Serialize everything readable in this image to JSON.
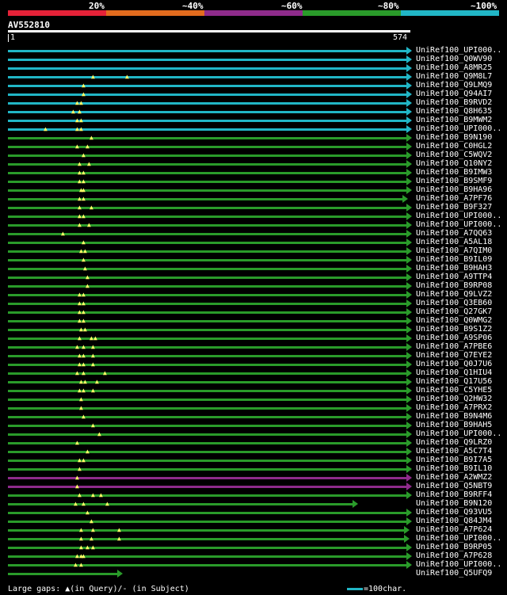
{
  "legend": {
    "labels": [
      "20%",
      "~40%",
      "~60%",
      "~80%",
      "~100%"
    ],
    "colors": [
      "#e52238",
      "#e36c1e",
      "#8e2b8b",
      "#2a9b2a",
      "#21b6c6"
    ]
  },
  "query": {
    "title": "AV552810",
    "start": "1",
    "end": "574"
  },
  "colors": {
    "cyan": "#21b6c6",
    "green": "#2a9b2a",
    "purple": "#8e2b8b",
    "gap_marker": "#ffff66"
  },
  "hits": [
    {
      "label": "UniRef100_UPI000..",
      "color": "cyan",
      "end_frac": 1.0,
      "gaps": []
    },
    {
      "label": "UniRef100_Q0WV90",
      "color": "cyan",
      "end_frac": 1.0,
      "gaps": []
    },
    {
      "label": "UniRef100_A8MR25",
      "color": "cyan",
      "end_frac": 1.0,
      "gaps": []
    },
    {
      "label": "UniRef100_Q9M8L7",
      "color": "cyan",
      "end_frac": 1.0,
      "gaps": [
        0.215,
        0.3
      ]
    },
    {
      "label": "UniRef100_Q9LMQ9",
      "color": "cyan",
      "end_frac": 1.0,
      "gaps": [
        0.19
      ]
    },
    {
      "label": "UniRef100_Q94AI7",
      "color": "cyan",
      "end_frac": 1.0,
      "gaps": [
        0.19
      ]
    },
    {
      "label": "UniRef100_B9RVD2",
      "color": "cyan",
      "end_frac": 1.0,
      "gaps": [
        0.175,
        0.185
      ]
    },
    {
      "label": "UniRef100_Q8H635",
      "color": "cyan",
      "end_frac": 1.0,
      "gaps": [
        0.165,
        0.18
      ]
    },
    {
      "label": "UniRef100_B9MWM2",
      "color": "cyan",
      "end_frac": 1.0,
      "gaps": [
        0.175,
        0.185
      ]
    },
    {
      "label": "UniRef100_UPI000..",
      "color": "cyan",
      "end_frac": 1.0,
      "gaps": [
        0.095,
        0.175,
        0.185
      ]
    },
    {
      "label": "UniRef100_B9N190",
      "color": "green",
      "end_frac": 1.0,
      "gaps": [
        0.21
      ]
    },
    {
      "label": "UniRef100_C0HGL2",
      "color": "green",
      "end_frac": 1.0,
      "gaps": [
        0.175,
        0.2
      ]
    },
    {
      "label": "UniRef100_C5WQV2",
      "color": "green",
      "end_frac": 1.0,
      "gaps": [
        0.19
      ]
    },
    {
      "label": "UniRef100_Q10NY2",
      "color": "green",
      "end_frac": 1.0,
      "gaps": [
        0.18,
        0.205
      ]
    },
    {
      "label": "UniRef100_B9IMW3",
      "color": "green",
      "end_frac": 1.0,
      "gaps": [
        0.18,
        0.19
      ]
    },
    {
      "label": "UniRef100_B9SMF9",
      "color": "green",
      "end_frac": 1.0,
      "gaps": [
        0.18,
        0.19
      ]
    },
    {
      "label": "UniRef100_B9HA96",
      "color": "green",
      "end_frac": 1.0,
      "gaps": [
        0.185,
        0.19
      ]
    },
    {
      "label": "UniRef100_A7PF76",
      "color": "green",
      "end_frac": 0.99,
      "gaps": [
        0.18,
        0.19
      ]
    },
    {
      "label": "UniRef100_B9F327",
      "color": "green",
      "end_frac": 1.0,
      "gaps": [
        0.18,
        0.21
      ]
    },
    {
      "label": "UniRef100_UPI000..",
      "color": "green",
      "end_frac": 1.0,
      "gaps": [
        0.18,
        0.19
      ]
    },
    {
      "label": "UniRef100_UPI000..",
      "color": "green",
      "end_frac": 1.0,
      "gaps": [
        0.18,
        0.205
      ]
    },
    {
      "label": "UniRef100_A7QQ63",
      "color": "green",
      "end_frac": 1.0,
      "gaps": [
        0.14
      ]
    },
    {
      "label": "UniRef100_A5AL18",
      "color": "green",
      "end_frac": 1.0,
      "gaps": [
        0.19
      ]
    },
    {
      "label": "UniRef100_A7QIM0",
      "color": "green",
      "end_frac": 1.0,
      "gaps": [
        0.185,
        0.195
      ]
    },
    {
      "label": "UniRef100_B9IL09",
      "color": "green",
      "end_frac": 1.0,
      "gaps": [
        0.19
      ]
    },
    {
      "label": "UniRef100_B9HAH3",
      "color": "green",
      "end_frac": 1.0,
      "gaps": [
        0.195
      ]
    },
    {
      "label": "UniRef100_A9TTP4",
      "color": "green",
      "end_frac": 1.0,
      "gaps": [
        0.2
      ]
    },
    {
      "label": "UniRef100_B9RP08",
      "color": "green",
      "end_frac": 1.0,
      "gaps": [
        0.2
      ]
    },
    {
      "label": "UniRef100_Q9LVZ2",
      "color": "green",
      "end_frac": 1.0,
      "gaps": [
        0.18,
        0.19
      ]
    },
    {
      "label": "UniRef100_Q3EB60",
      "color": "green",
      "end_frac": 1.0,
      "gaps": [
        0.18,
        0.19
      ]
    },
    {
      "label": "UniRef100_Q27GK7",
      "color": "green",
      "end_frac": 1.0,
      "gaps": [
        0.18,
        0.19
      ]
    },
    {
      "label": "UniRef100_Q0WMG2",
      "color": "green",
      "end_frac": 1.0,
      "gaps": [
        0.18,
        0.19
      ]
    },
    {
      "label": "UniRef100_B9S1Z2",
      "color": "green",
      "end_frac": 1.0,
      "gaps": [
        0.185,
        0.195
      ]
    },
    {
      "label": "UniRef100_A9SP06",
      "color": "green",
      "end_frac": 1.0,
      "gaps": [
        0.18,
        0.21,
        0.22
      ]
    },
    {
      "label": "UniRef100_A7PBE6",
      "color": "green",
      "end_frac": 1.0,
      "gaps": [
        0.175,
        0.19,
        0.215
      ]
    },
    {
      "label": "UniRef100_Q7EYE2",
      "color": "green",
      "end_frac": 1.0,
      "gaps": [
        0.18,
        0.19,
        0.215
      ]
    },
    {
      "label": "UniRef100_Q0J7U6",
      "color": "green",
      "end_frac": 1.0,
      "gaps": [
        0.18,
        0.19,
        0.215
      ]
    },
    {
      "label": "UniRef100_Q1HIU4",
      "color": "green",
      "end_frac": 1.0,
      "gaps": [
        0.175,
        0.19,
        0.245
      ]
    },
    {
      "label": "UniRef100_Q17U56",
      "color": "green",
      "end_frac": 1.0,
      "gaps": [
        0.185,
        0.195,
        0.225
      ]
    },
    {
      "label": "UniRef100_C5YHE5",
      "color": "green",
      "end_frac": 1.0,
      "gaps": [
        0.18,
        0.19,
        0.215
      ]
    },
    {
      "label": "UniRef100_Q2HW32",
      "color": "green",
      "end_frac": 1.0,
      "gaps": [
        0.185
      ]
    },
    {
      "label": "UniRef100_A7PRX2",
      "color": "green",
      "end_frac": 1.0,
      "gaps": [
        0.185
      ]
    },
    {
      "label": "UniRef100_B9N4M6",
      "color": "green",
      "end_frac": 1.0,
      "gaps": [
        0.19
      ]
    },
    {
      "label": "UniRef100_B9HAH5",
      "color": "green",
      "end_frac": 1.0,
      "gaps": [
        0.215
      ]
    },
    {
      "label": "UniRef100_UPI000..",
      "color": "green",
      "end_frac": 1.0,
      "gaps": [
        0.23
      ]
    },
    {
      "label": "UniRef100_Q9LRZ0",
      "color": "green",
      "end_frac": 1.0,
      "gaps": [
        0.175
      ]
    },
    {
      "label": "UniRef100_A5C7T4",
      "color": "green",
      "end_frac": 1.0,
      "gaps": [
        0.2
      ]
    },
    {
      "label": "UniRef100_B9I7A5",
      "color": "green",
      "end_frac": 1.0,
      "gaps": [
        0.18,
        0.19
      ]
    },
    {
      "label": "UniRef100_B9IL10",
      "color": "green",
      "end_frac": 1.0,
      "gaps": [
        0.18
      ]
    },
    {
      "label": "UniRef100_A2WMZ2",
      "color": "purple",
      "end_frac": 1.0,
      "gaps": [
        0.175
      ]
    },
    {
      "label": "UniRef100_Q5NBT9",
      "color": "purple",
      "end_frac": 1.0,
      "gaps": [
        0.175
      ]
    },
    {
      "label": "UniRef100_B9RFF4",
      "color": "green",
      "end_frac": 1.0,
      "gaps": [
        0.18,
        0.215,
        0.235
      ]
    },
    {
      "label": "UniRef100_B9N120",
      "color": "green",
      "end_frac": 0.865,
      "gaps": [
        0.17,
        0.19,
        0.25
      ]
    },
    {
      "label": "UniRef100_Q93VU5",
      "color": "green",
      "end_frac": 1.0,
      "gaps": [
        0.2
      ]
    },
    {
      "label": "UniRef100_Q84JM4",
      "color": "green",
      "end_frac": 1.0,
      "gaps": [
        0.21
      ]
    },
    {
      "label": "UniRef100_A7P624",
      "color": "green",
      "end_frac": 0.995,
      "gaps": [
        0.185,
        0.215,
        0.28
      ]
    },
    {
      "label": "UniRef100_UPI000..",
      "color": "green",
      "end_frac": 0.995,
      "gaps": [
        0.185,
        0.21,
        0.28
      ]
    },
    {
      "label": "UniRef100_B9RP05",
      "color": "green",
      "end_frac": 1.0,
      "gaps": [
        0.185,
        0.2,
        0.215
      ]
    },
    {
      "label": "UniRef100_A7P628",
      "color": "green",
      "end_frac": 1.0,
      "gaps": [
        0.175,
        0.185,
        0.19
      ]
    },
    {
      "label": "UniRef100_UPI000..",
      "color": "green",
      "end_frac": 1.0,
      "gaps": [
        0.17,
        0.185
      ]
    },
    {
      "label": "UniRef100_Q5UFQ9",
      "color": "green",
      "end_frac": 0.275,
      "gaps": []
    }
  ],
  "footer": {
    "large_gaps": "Large gaps: ▲(in Query)/- (in Subject)",
    "scale": "=100char."
  }
}
